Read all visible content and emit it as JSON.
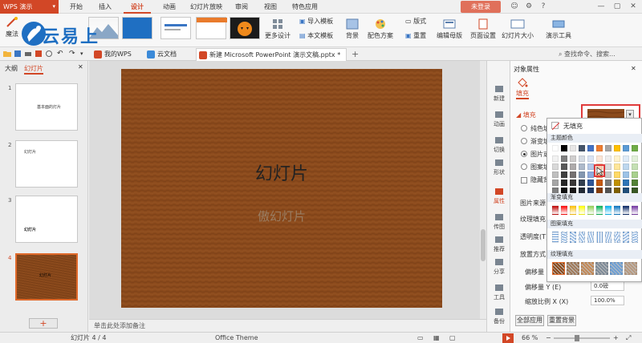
{
  "app": {
    "name": "WPS 演示",
    "login": "未登录"
  },
  "menu": [
    "开始",
    "插入",
    "设计",
    "动画",
    "幻灯片放映",
    "审阅",
    "视图",
    "特色应用"
  ],
  "menu_active_index": 2,
  "ribbon": {
    "magic": "魔法",
    "more_design": "更多设计",
    "import_template": "导入模板",
    "text_template": "本文模板",
    "background": "背景",
    "color_scheme": "配色方案",
    "layout": "版式",
    "rearrange": "重置",
    "edit_master": "编辑母版",
    "page_setup": "页面设置",
    "slide_size": "幻灯片大小",
    "presentation_tools": "演示工具"
  },
  "logo_text": "云易上",
  "tabs": [
    {
      "label": "我的WPS",
      "icon_color": "#d24726"
    },
    {
      "label": "云文档",
      "icon_color": "#3b8ad8"
    },
    {
      "label": "新建 Microsoft PowerPoint 演示文稿.pptx *",
      "icon_color": "#d24726"
    }
  ],
  "search": {
    "label": "查找命令、搜索..."
  },
  "left_panel": {
    "tab_outline": "大纲",
    "tab_slides": "幻灯片"
  },
  "slides": [
    {
      "num": "1",
      "text": "基本面的灯片"
    },
    {
      "num": "2",
      "text": "幻灯片"
    },
    {
      "num": "3",
      "text": "幻灯片"
    },
    {
      "num": "4",
      "text": "幻灯片"
    }
  ],
  "canvas": {
    "title": "幻灯片",
    "subtitle": "傲幻灯片",
    "notes_placeholder": "单击此处添加备注"
  },
  "taskpane": [
    {
      "label": "新建",
      "icon": "new-icon"
    },
    {
      "label": "动画",
      "icon": "animation-icon"
    },
    {
      "label": "切换",
      "icon": "transition-icon"
    },
    {
      "label": "形状",
      "icon": "shape-icon"
    },
    {
      "label": "属性",
      "icon": "properties-icon"
    },
    {
      "label": "传图",
      "icon": "upload-image-icon"
    },
    {
      "label": "推荐",
      "icon": "recommend-icon"
    },
    {
      "label": "分享",
      "icon": "share-icon"
    },
    {
      "label": "工具",
      "icon": "tools-icon"
    },
    {
      "label": "备份",
      "icon": "backup-icon"
    }
  ],
  "properties": {
    "header": "对象属性",
    "fill_tab": "填充",
    "fill_section": "填充",
    "options": [
      "纯色填",
      "渐变填",
      "图片或",
      "图案填"
    ],
    "hide_bg": "隐藏背",
    "picture_source": "图片来源",
    "texture_fill": "纹理填充",
    "transparency": "透明度(T)",
    "tile_mode": "放置方式",
    "offset": "偏移量",
    "offset_y_label": "偏移量 Y (E)",
    "offset_y_value": "0.0磅",
    "scale_x_label": "缩放比例 X (X)",
    "scale_x_value": "100.0%",
    "apply_all": "全部应用",
    "reset_bg": "重置背景"
  },
  "dropdown": {
    "no_fill": "无填充",
    "theme_colors": "主题颜色",
    "gradient_fill": "渐变填充",
    "pattern_fill": "图案填充",
    "texture_fill": "纹理填充"
  },
  "status": {
    "slide_count": "幻灯片 4 / 4",
    "theme": "Office Theme",
    "zoom": "66 %"
  },
  "colors": {
    "accent": "#d24726",
    "wood": "#8b4a1c",
    "highlight": "#e03a3a"
  }
}
